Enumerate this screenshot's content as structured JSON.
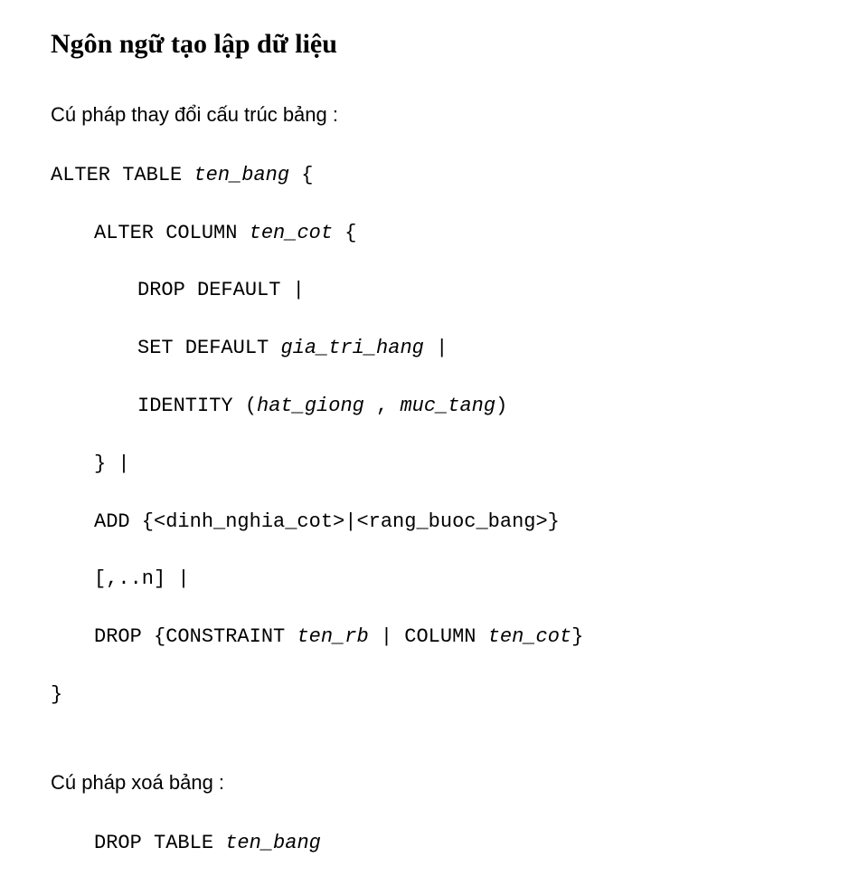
{
  "title": "Ngôn ngữ tạo lập dữ liệu",
  "section1_heading": "Cú pháp thay đổi cấu trúc bảng :",
  "code": {
    "l0_kw": "ALTER TABLE ",
    "l0_it": "ten_bang",
    "l0_end": " {",
    "l1_kw": "ALTER COLUMN ",
    "l1_it": "ten_cot",
    "l1_end": " {",
    "l2": "DROP DEFAULT |",
    "l3_kw": "SET DEFAULT ",
    "l3_it": "gia_tri_hang",
    "l3_end": " |",
    "l4_kw": "IDENTITY (",
    "l4_it1": "hat_giong",
    "l4_mid": " , ",
    "l4_it2": "muc_tang",
    "l4_end": ")",
    "l5": "} |",
    "l6a": "ADD {<dinh_nghia_cot>|<rang_buoc_bang>}",
    "l6b": "[,..n] |",
    "l7_kw1": "DROP {CONSTRAINT ",
    "l7_it1": "ten_rb",
    "l7_mid": " | COLUMN ",
    "l7_it2": "ten_cot",
    "l7_end": "}",
    "l8": "}"
  },
  "section2_heading": "Cú pháp xoá bảng :",
  "code2": {
    "l0_kw": "DROP TABLE ",
    "l0_it": "ten_bang"
  }
}
